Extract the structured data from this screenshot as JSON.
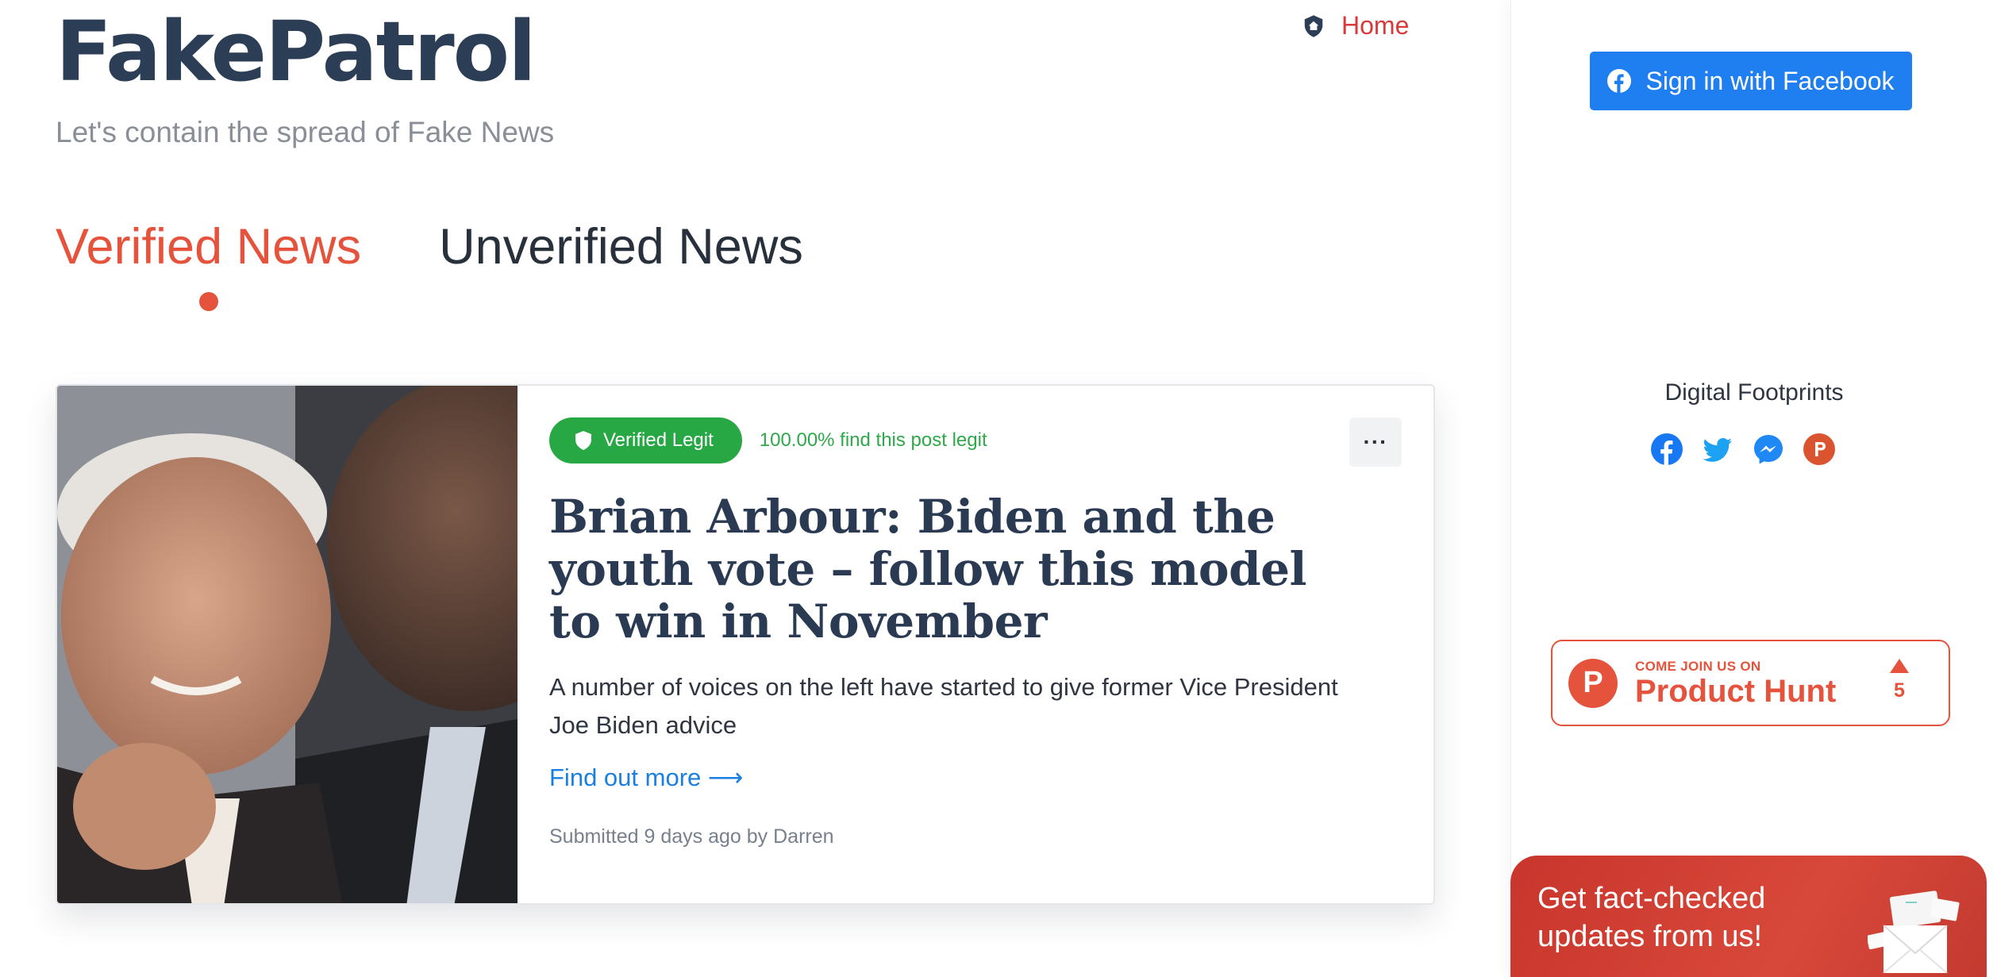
{
  "site": {
    "logo": "FakePatrol",
    "tagline": "Let's contain the spread of Fake News"
  },
  "nav": {
    "home_label": "Home"
  },
  "tabs": [
    {
      "label": "Verified News",
      "active": true
    },
    {
      "label": "Unverified News",
      "active": false
    }
  ],
  "post": {
    "badge_label": "Verified Legit",
    "legit_text": "100.00% find this post legit",
    "more_label": "···",
    "headline": "Brian Arbour: Biden and the youth vote – follow this model to win in November",
    "excerpt": "A number of voices on the left have started to give former Vice President Joe Biden advice",
    "find_more_label": "Find out more ⟶",
    "submitted": "Submitted 9 days ago by Darren"
  },
  "sidebar": {
    "facebook_button": "Sign in with Facebook",
    "footprints_title": "Digital Footprints",
    "social_icons": [
      "facebook-icon",
      "twitter-icon",
      "messenger-icon",
      "producthunt-icon"
    ],
    "product_hunt": {
      "small_text": "COME JOIN US ON",
      "big_text": "Product Hunt",
      "votes": "5"
    },
    "newsletter_line1": "Get fact-checked",
    "newsletter_line2": "updates from us!"
  },
  "colors": {
    "brand_dark": "#2c3e56",
    "accent_red": "#e5533c",
    "verified_green": "#28a745",
    "facebook_blue": "#1f7ef0",
    "link_blue": "#1a7fe0"
  }
}
